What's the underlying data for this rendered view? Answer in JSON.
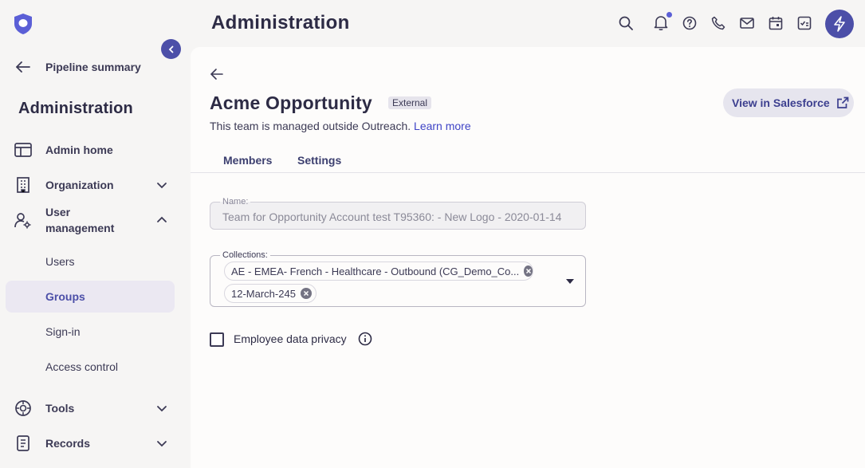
{
  "header": {
    "title": "Administration",
    "icons": [
      "search-icon",
      "bell-icon",
      "help-icon",
      "phone-icon",
      "mail-icon",
      "calendar-icon",
      "tasks-icon",
      "bolt-icon"
    ]
  },
  "sidebar": {
    "back_label": "Pipeline summary",
    "title": "Administration",
    "items": [
      {
        "label": "Admin home",
        "icon": "layout-icon"
      },
      {
        "label": "Organization",
        "icon": "building-icon"
      },
      {
        "label": "User management",
        "icon": "user-gear-icon"
      },
      {
        "label": "Tools",
        "icon": "tools-icon"
      },
      {
        "label": "Records",
        "icon": "records-icon"
      }
    ],
    "user_management_label_line1": "User",
    "user_management_label_line2": "management",
    "sub_items": [
      "Users",
      "Groups",
      "Sign-in",
      "Access control"
    ],
    "active_sub_item": "Groups"
  },
  "team": {
    "title": "Acme Opportunity",
    "badge": "External",
    "managed_text": "This team is managed outside Outreach.",
    "learn_more": "Learn more",
    "salesforce_button": "View in Salesforce"
  },
  "tabs": [
    "Members",
    "Settings"
  ],
  "form": {
    "name_label": "Name:",
    "name_value": "Team for Opportunity Account test T95360: - New Logo - 2020-01-14",
    "collections_label": "Collections:",
    "collections": [
      "AE - EMEA- French - Healthcare - Outbound (CG_Demo_Co...",
      "12-March-245"
    ],
    "privacy_label": "Employee data privacy",
    "privacy_checked": false
  },
  "colors": {
    "accent": "#4c4fa8",
    "link": "#3f44c6",
    "sidebar_bg": "#f6f5f4",
    "main_bg": "#fdfcfb"
  }
}
